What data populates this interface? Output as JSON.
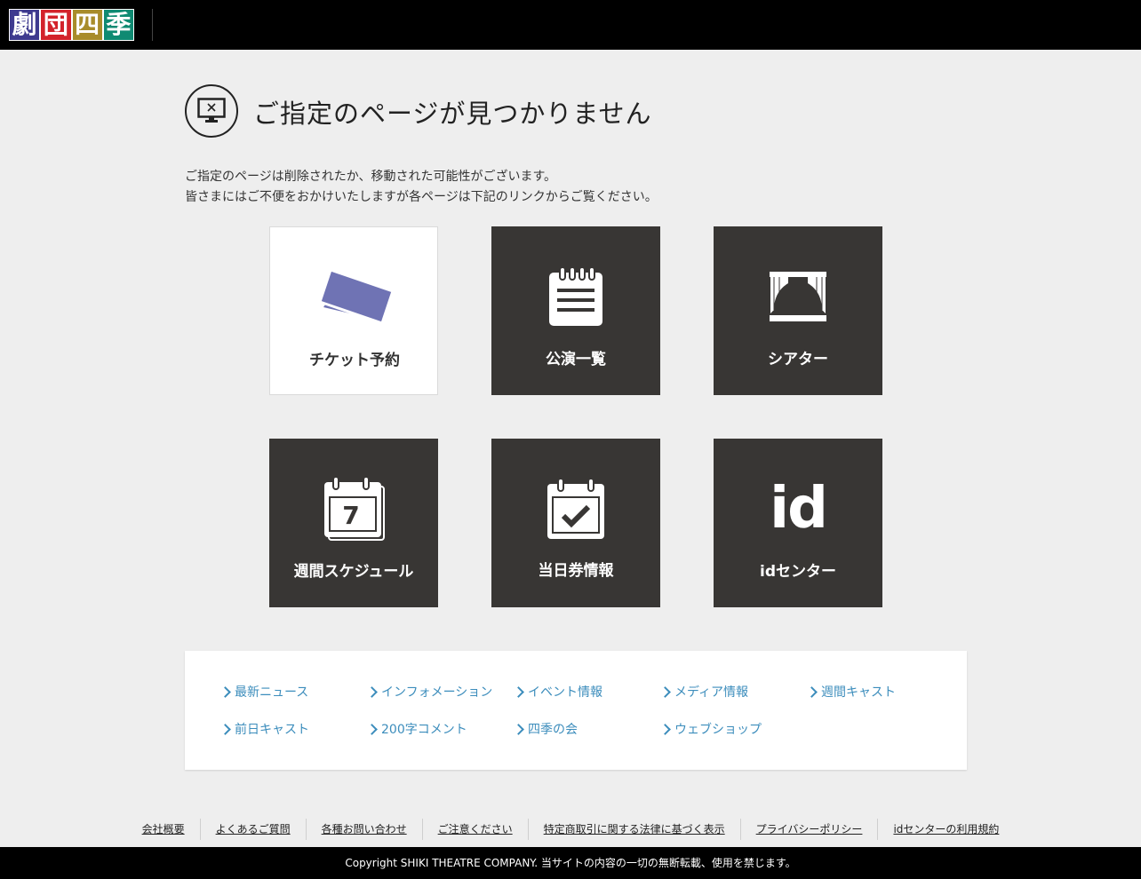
{
  "header": {
    "logo_chars": [
      "劇",
      "団",
      "四",
      "季"
    ],
    "logo_colors": [
      "#3e3a8f",
      "#d3232b",
      "#a88c2a",
      "#0f8a72"
    ]
  },
  "title": {
    "text": "ご指定のページが見つかりません",
    "icon": "monitor-x-icon"
  },
  "description": {
    "line1": "ご指定のページは削除されたか、移動された可能性がございます。",
    "line2": "皆さまにはご不便をおかけいたしますが各ページは下記のリンクからご覧ください。"
  },
  "tiles": [
    {
      "label": "チケット予約",
      "icon": "ticket-icon",
      "accent": "#6f73b4"
    },
    {
      "label": "公演一覧",
      "icon": "list-notepad-icon"
    },
    {
      "label": "シアター",
      "icon": "theater-curtain-icon"
    },
    {
      "label": "週間スケジュール",
      "icon": "weekly-calendar-icon",
      "day": "7"
    },
    {
      "label": "当日券情報",
      "icon": "calendar-check-icon"
    },
    {
      "label": "idセンター",
      "icon": "id-icon",
      "glyph": "id"
    }
  ],
  "links": [
    "最新ニュース",
    "インフォメーション",
    "イベント情報",
    "メディア情報",
    "週間キャスト",
    "前日キャスト",
    "200字コメント",
    "四季の会",
    "ウェブショップ"
  ],
  "footer_links": [
    "会社概要",
    "よくあるご質問",
    "各種お問い合わせ",
    "ご注意ください",
    "特定商取引に関する法律に基づく表示",
    "プライバシーポリシー",
    "idセンターの利用規約"
  ],
  "copyright": "Copyright SHIKI THEATRE COMPANY. 当サイトの内容の一切の無断転載、使用を禁じます。"
}
